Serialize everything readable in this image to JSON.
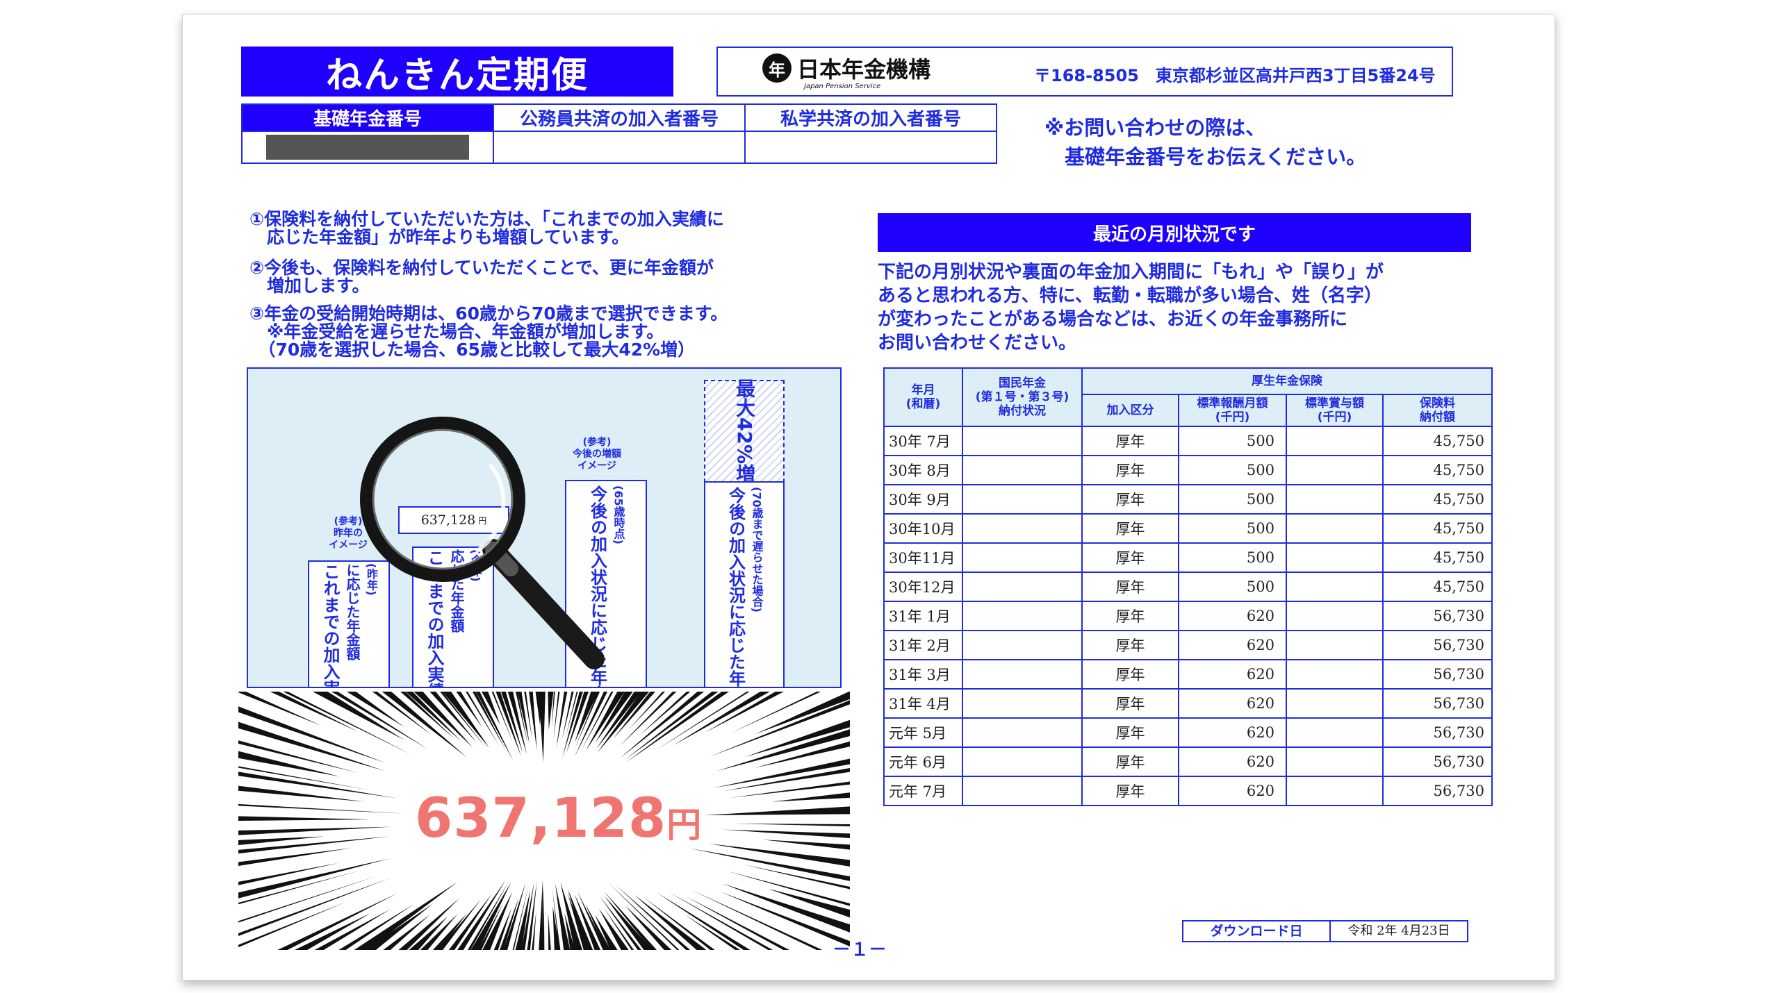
{
  "header": {
    "title": "ねんきん定期便",
    "org_mark": "年",
    "org_name": "日本年金機構",
    "org_name_en": "Japan Pension Service",
    "address": "〒168-8505　東京都杉並区高井戸西3丁目5番24号"
  },
  "numbers_table": {
    "headers": [
      "基礎年金番号",
      "公務員共済の加入者番号",
      "私学共済の加入者番号"
    ]
  },
  "contact_note": [
    "※お問い合わせの際は、",
    "　基礎年金番号をお伝えください。"
  ],
  "notes": {
    "n1_l1": "①保険料を納付していただいた方は、「これまでの加入実績に",
    "n1_l2": "　応じた年金額」が昨年よりも増額しています。",
    "n2_l1": "②今後も、保険料を納付していただくことで、更に年金額が",
    "n2_l2": "　増加します。",
    "n3_l1": "③年金の受給開始時期は、60歳から70歳まで選択できます。",
    "n3_l2": "　※年金受給を遅らせた場合、年金額が増加します。",
    "n3_l3": "　（70歳を選択した場合、65歳と比較して最大42%増）"
  },
  "graph": {
    "bar1": {
      "caption1": "(参考)",
      "caption2": "昨年の",
      "caption3": "イメージ",
      "main": "これまでの加入実績",
      "sub": "に応じた年金額",
      "note": "(昨年)"
    },
    "bar2": {
      "main": "これまでの加入実績",
      "sub": "応じた年金額",
      "note": "(今年)"
    },
    "bar3": {
      "caption1": "(参考)",
      "caption2": "今後の増額",
      "caption3": "イメージ",
      "main": "今後の加入状況に応じた年金額",
      "note": "(65歳時点)"
    },
    "bar4": {
      "top": "最大42%増",
      "main": "今後の加入状況に応じた年金額",
      "note": "(70歳まで遅らせた場合)"
    },
    "amount": "637,128",
    "amount_unit": "円"
  },
  "big_amount": {
    "value": "637,128",
    "unit": "円"
  },
  "monthly": {
    "heading": "最近の月別状況です",
    "note": [
      "下記の月別状況や裏面の年金加入期間に「もれ」や「誤り」が",
      "あると思われる方、特に、転勤・転職が多い場合、姓（名字）",
      "が変わったことがある場合などは、お近くの年金事務所に",
      "お問い合わせください。"
    ],
    "col_year": [
      "年月",
      "(和暦)"
    ],
    "col_kokumin": [
      "国民年金",
      "(第１号・第３号)",
      "納付状況"
    ],
    "col_kosei": "厚生年金保険",
    "sub_cols": [
      [
        "加入区分"
      ],
      [
        "標準報酬月額",
        "(千円)"
      ],
      [
        "標準賞与額",
        "(千円)"
      ],
      [
        "保険料",
        "納付額"
      ]
    ],
    "rows": [
      {
        "month": "30年 7月",
        "kokumin": "",
        "kubun": "厚年",
        "hoshu": "500",
        "shoyo": "",
        "hokenryo": "45,750"
      },
      {
        "month": "30年 8月",
        "kokumin": "",
        "kubun": "厚年",
        "hoshu": "500",
        "shoyo": "",
        "hokenryo": "45,750"
      },
      {
        "month": "30年 9月",
        "kokumin": "",
        "kubun": "厚年",
        "hoshu": "500",
        "shoyo": "",
        "hokenryo": "45,750"
      },
      {
        "month": "30年10月",
        "kokumin": "",
        "kubun": "厚年",
        "hoshu": "500",
        "shoyo": "",
        "hokenryo": "45,750"
      },
      {
        "month": "30年11月",
        "kokumin": "",
        "kubun": "厚年",
        "hoshu": "500",
        "shoyo": "",
        "hokenryo": "45,750"
      },
      {
        "month": "30年12月",
        "kokumin": "",
        "kubun": "厚年",
        "hoshu": "500",
        "shoyo": "",
        "hokenryo": "45,750"
      },
      {
        "month": "31年 1月",
        "kokumin": "",
        "kubun": "厚年",
        "hoshu": "620",
        "shoyo": "",
        "hokenryo": "56,730"
      },
      {
        "month": "31年 2月",
        "kokumin": "",
        "kubun": "厚年",
        "hoshu": "620",
        "shoyo": "",
        "hokenryo": "56,730"
      },
      {
        "month": "31年 3月",
        "kokumin": "",
        "kubun": "厚年",
        "hoshu": "620",
        "shoyo": "",
        "hokenryo": "56,730"
      },
      {
        "month": "31年 4月",
        "kokumin": "",
        "kubun": "厚年",
        "hoshu": "620",
        "shoyo": "",
        "hokenryo": "56,730"
      },
      {
        "month": "元年 5月",
        "kokumin": "",
        "kubun": "厚年",
        "hoshu": "620",
        "shoyo": "",
        "hokenryo": "56,730"
      },
      {
        "month": "元年 6月",
        "kokumin": "",
        "kubun": "厚年",
        "hoshu": "620",
        "shoyo": "",
        "hokenryo": "56,730"
      },
      {
        "month": "元年 7月",
        "kokumin": "",
        "kubun": "厚年",
        "hoshu": "620",
        "shoyo": "",
        "hokenryo": "56,730"
      }
    ]
  },
  "download": {
    "label": "ダウンロード日",
    "value": "令和 2年 4月23日"
  },
  "page_number": "－１－",
  "colors": {
    "brand_blue": "#1f00ff",
    "text_blue": "#1f2be0",
    "graph_bg": "#ddeef6",
    "amount_pink": "#f07470"
  },
  "icons": [
    "magnifier-icon",
    "jps-logo-icon"
  ]
}
